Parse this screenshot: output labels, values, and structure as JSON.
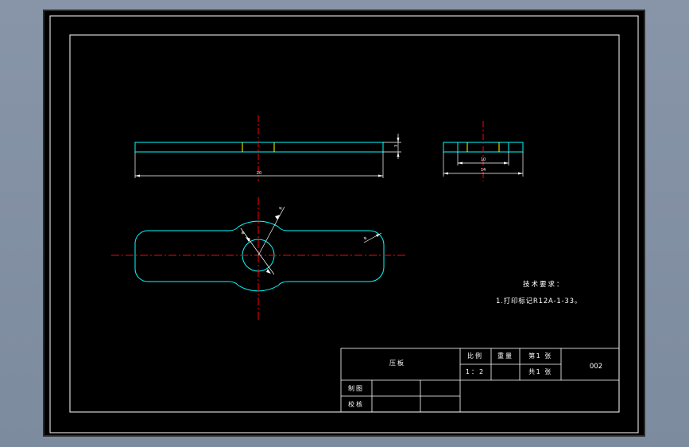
{
  "drawing": {
    "dimensions": {
      "top_view_length": "20",
      "top_view_thickness": "3",
      "side_view_inner": "10",
      "side_view_outer": "14",
      "radius_large": "R",
      "radius_hole": "Φ",
      "radius_end": "R"
    },
    "technical_requirements": {
      "heading": "技术要求：",
      "items": [
        "1.打印标记R12A-1-33。"
      ]
    },
    "title_block": {
      "part_name": "压板",
      "scale_label": "比例",
      "scale_value": "1：2",
      "weight_label": "重量",
      "sheet_label": "第1 张",
      "total_label": "共1 张",
      "drawing_number": "002",
      "drawn_by_label": "制图",
      "checked_by_label": "校核"
    }
  },
  "colors": {
    "background": "#000000",
    "frame": "#ffffff",
    "outline": "#00ffff",
    "center_line": "#ff0000",
    "dimension": "#ffffff",
    "accent": "#ffff00"
  }
}
